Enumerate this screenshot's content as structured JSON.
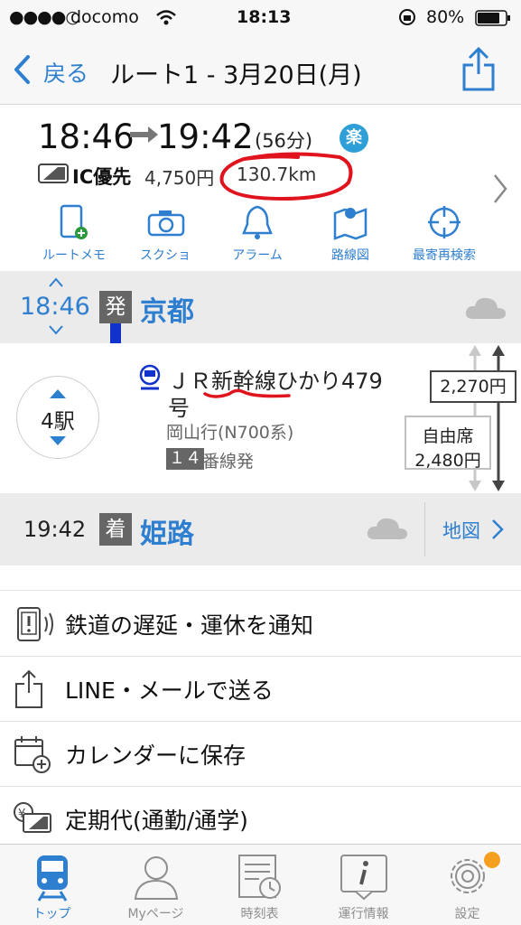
{
  "status_bar": {
    "carrier": "docomo",
    "time": "18:13",
    "battery": "80%"
  },
  "nav": {
    "back_label": "戻る",
    "title": "ルート1 - 3月20日(月)"
  },
  "summary": {
    "depart_time": "18:46",
    "arrive_time": "19:42",
    "duration": "(56分)",
    "raku_badge": "楽",
    "ic_label": "IC優先",
    "fare": "4,750円",
    "distance": "130.7km",
    "actions": [
      {
        "label": "ルートメモ",
        "icon": "route-memo-icon"
      },
      {
        "label": "スクショ",
        "icon": "camera-icon"
      },
      {
        "label": "アラーム",
        "icon": "bell-icon"
      },
      {
        "label": "路線図",
        "icon": "map-icon"
      },
      {
        "label": "最寄再検索",
        "icon": "crosshair-icon"
      }
    ]
  },
  "route": {
    "from": {
      "time": "18:46",
      "badge": "発",
      "station": "京都"
    },
    "to": {
      "time": "19:42",
      "badge": "着",
      "station": "姫路",
      "map_link": "地図"
    },
    "stops": "4駅",
    "train_line1": "ＪＲ新幹線ひかり479",
    "train_line2": "号",
    "destination": "岡山行(N700系)",
    "platform_num": "１４",
    "platform_text": "番線発",
    "fare_ic": "2,270円",
    "seat_type": "自由席",
    "seat_fare": "2,480円"
  },
  "list": [
    {
      "label": "鉄道の遅延・運休を通知",
      "icon": "phone-vibrate-icon"
    },
    {
      "label": "LINE・メールで送る",
      "icon": "share-icon"
    },
    {
      "label": "カレンダーに保存",
      "icon": "calendar-add-icon"
    },
    {
      "label": "定期代(通勤/通学)",
      "icon": "commuter-pass-icon"
    }
  ],
  "tabs": [
    {
      "label": "トップ",
      "active": true
    },
    {
      "label": "Myページ",
      "active": false
    },
    {
      "label": "時刻表",
      "active": false
    },
    {
      "label": "運行情報",
      "active": false
    },
    {
      "label": "設定",
      "active": false
    }
  ],
  "colors": {
    "accent": "#2f7fd0",
    "annotation_red": "#e0141e",
    "train_line": "#1133cc",
    "badge_orange": "#f5a020"
  }
}
